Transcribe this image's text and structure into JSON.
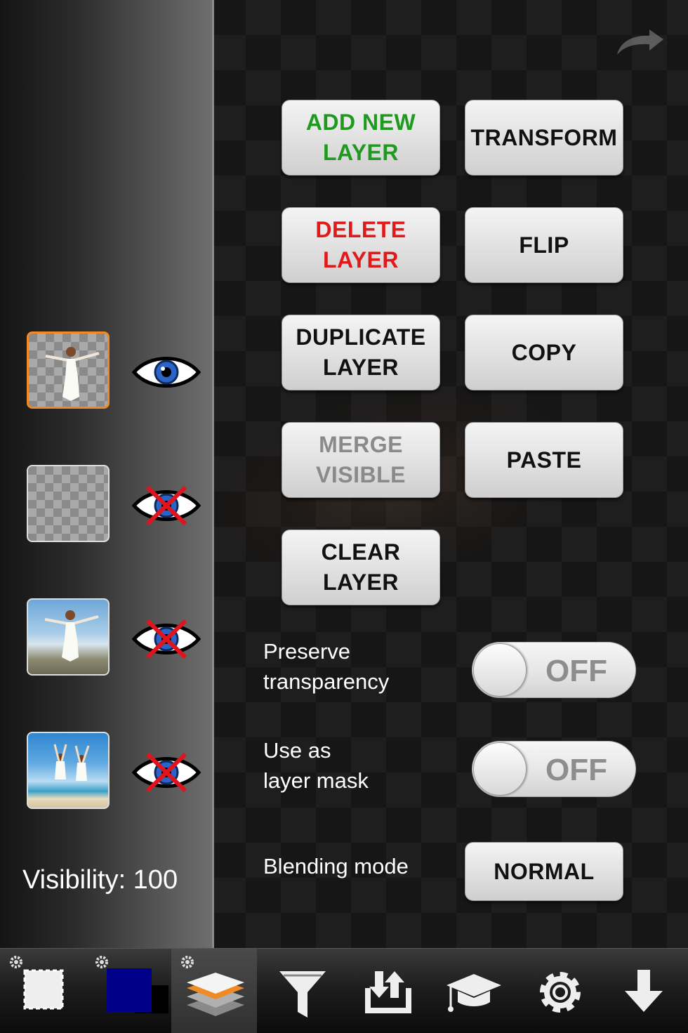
{
  "layers": [
    {
      "thumbnail": "dancer-cutout",
      "visible": true,
      "selected": true
    },
    {
      "thumbnail": "empty-transparent",
      "visible": false,
      "selected": false
    },
    {
      "thumbnail": "dancer-on-beach",
      "visible": false,
      "selected": false
    },
    {
      "thumbnail": "couple-jumping-beach",
      "visible": false,
      "selected": false
    }
  ],
  "visibility_label": "Visibility: 100",
  "buttons": {
    "add_new_layer": "ADD NEW\nLAYER",
    "transform": "TRANSFORM",
    "delete_layer": "DELETE\nLAYER",
    "flip": "FLIP",
    "duplicate_layer": "DUPLICATE\nLAYER",
    "copy": "COPY",
    "merge_visible": "MERGE\nVISIBLE",
    "paste": "PASTE",
    "clear_layer": "CLEAR\nLAYER"
  },
  "options": {
    "preserve_transparency_label": "Preserve\ntransparency",
    "preserve_transparency_value": "OFF",
    "layer_mask_label": "Use as\nlayer mask",
    "layer_mask_value": "OFF",
    "blending_mode_label": "Blending mode",
    "blending_mode_value": "NORMAL"
  },
  "colors": {
    "add_text": "#1f9a1f",
    "delete_text": "#e01a1a",
    "disabled_text": "#8a8a8a",
    "selected_border": "#f08a24",
    "primary_color": "#00008b",
    "eye_iris": "#2a64c8",
    "cross_out": "#e0141e"
  },
  "toolbar": [
    {
      "icon": "selection-icon"
    },
    {
      "icon": "color-swatch-icon"
    },
    {
      "icon": "layers-icon",
      "active": true
    },
    {
      "icon": "filter-icon"
    },
    {
      "icon": "import-export-icon"
    },
    {
      "icon": "tutorial-icon"
    },
    {
      "icon": "settings-icon"
    },
    {
      "icon": "download-icon"
    }
  ]
}
